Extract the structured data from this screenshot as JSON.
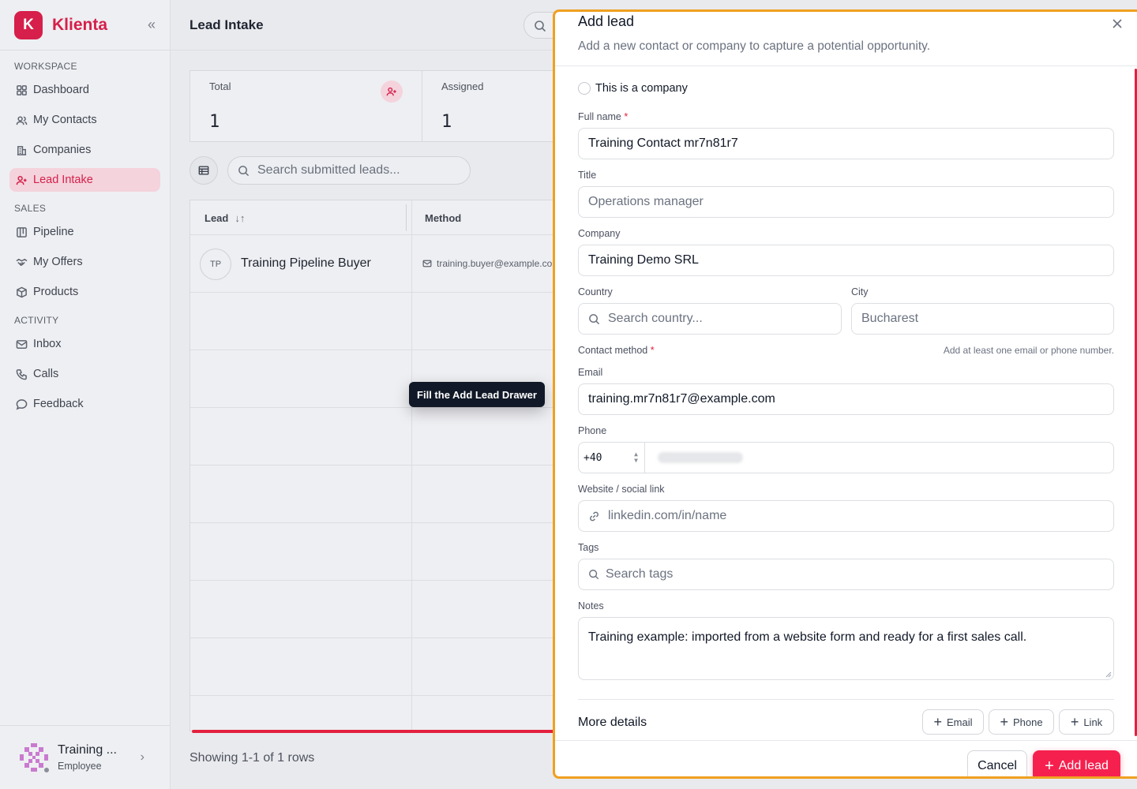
{
  "app": {
    "name": "Klienta",
    "logo_letter": "K",
    "brand_color": "#d61f4a"
  },
  "sidebar": {
    "sections": [
      {
        "label": "WORKSPACE"
      },
      {
        "label": "SALES"
      },
      {
        "label": "ACTIVITY"
      }
    ],
    "items": [
      {
        "label": "Dashboard",
        "icon": "grid-icon"
      },
      {
        "label": "My Contacts",
        "icon": "users-icon"
      },
      {
        "label": "Companies",
        "icon": "building-icon"
      },
      {
        "label": "Lead Intake",
        "icon": "user-plus-icon",
        "active": true
      },
      {
        "label": "Pipeline",
        "icon": "kanban-icon"
      },
      {
        "label": "My Offers",
        "icon": "handshake-icon"
      },
      {
        "label": "Products",
        "icon": "box-icon"
      },
      {
        "label": "Inbox",
        "icon": "mail-icon"
      },
      {
        "label": "Calls",
        "icon": "phone-icon"
      },
      {
        "label": "Feedback",
        "icon": "message-icon"
      }
    ],
    "user": {
      "name": "Training ...",
      "role": "Employee"
    }
  },
  "main": {
    "title": "Lead Intake",
    "stats": [
      {
        "label": "Total",
        "value": "1"
      },
      {
        "label": "Assigned",
        "value": "1"
      }
    ],
    "search_placeholder": "Search submitted leads...",
    "table": {
      "columns": [
        "Lead",
        "Method"
      ],
      "rows": [
        {
          "initials": "TP",
          "name": "Training Pipeline Buyer",
          "email": "training.buyer@example.com"
        }
      ]
    },
    "footer": "Showing 1-1 of 1 rows",
    "tooltip": "Fill the Add Lead Drawer"
  },
  "drawer": {
    "title": "Add lead",
    "subtitle": "Add a new contact or company to capture a potential opportunity.",
    "company_toggle": "This is a company",
    "full_name": {
      "label": "Full name",
      "value": "Training Contact mr7n81r7"
    },
    "title_field": {
      "label": "Title",
      "placeholder": "Operations manager"
    },
    "company": {
      "label": "Company",
      "value": "Training Demo SRL"
    },
    "country": {
      "label": "Country",
      "placeholder": "Search country..."
    },
    "city": {
      "label": "City",
      "placeholder": "Bucharest"
    },
    "contact_method": {
      "label": "Contact method",
      "hint": "Add at least one email or phone number."
    },
    "email": {
      "label": "Email",
      "value": "training.mr7n81r7@example.com"
    },
    "phone": {
      "label": "Phone",
      "code": "+40"
    },
    "website": {
      "label": "Website / social link",
      "placeholder": "linkedin.com/in/name"
    },
    "tags": {
      "label": "Tags",
      "placeholder": "Search tags"
    },
    "notes": {
      "label": "Notes",
      "value": "Training example: imported from a website form and ready for a first sales call."
    },
    "more_details": "More details",
    "chips": [
      "Email",
      "Phone",
      "Link"
    ],
    "cancel": "Cancel",
    "submit": "Add lead",
    "accent": "#f6204f"
  }
}
